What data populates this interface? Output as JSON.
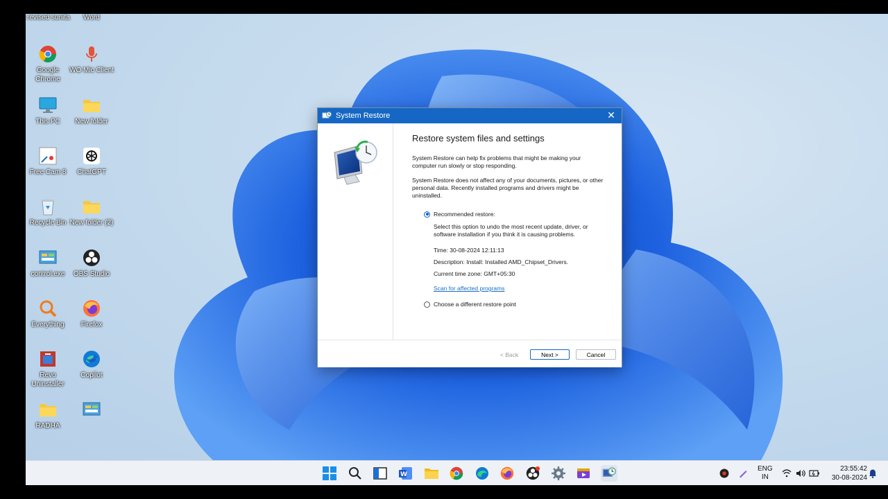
{
  "desktop": {
    "top_labels": [
      "revised sunita",
      "Word"
    ],
    "icons": [
      {
        "label": "Google Chrome",
        "icon": "chrome-icon"
      },
      {
        "label": "WO Mic Client",
        "icon": "microphone-icon"
      },
      {
        "label": "This PC",
        "icon": "monitor-icon"
      },
      {
        "label": "New folder",
        "icon": "folder-icon"
      },
      {
        "label": "Free Cam 8",
        "icon": "freecam-icon"
      },
      {
        "label": "ChatGPT",
        "icon": "chatgpt-icon"
      },
      {
        "label": "Recycle Bin",
        "icon": "recycle-bin-icon"
      },
      {
        "label": "New folder (2)",
        "icon": "folder-icon"
      },
      {
        "label": "control.exe",
        "icon": "control-panel-icon"
      },
      {
        "label": "OBS Studio",
        "icon": "obs-icon"
      },
      {
        "label": "Everything",
        "icon": "search-everything-icon"
      },
      {
        "label": "Firefox",
        "icon": "firefox-icon"
      },
      {
        "label": "Revo Uninstaller",
        "icon": "revo-icon"
      },
      {
        "label": "Copilot",
        "icon": "copilot-icon"
      },
      {
        "label": "RADHA",
        "icon": "folder-icon"
      },
      {
        "label": "",
        "icon": "control-panel-icon"
      }
    ]
  },
  "dialog": {
    "title": "System Restore",
    "heading": "Restore system files and settings",
    "para1": "System Restore can help fix problems that might be making your computer run slowly or stop responding.",
    "para2": "System Restore does not affect any of your documents, pictures, or other personal data. Recently installed programs and drivers might be uninstalled.",
    "option_recommended": "Recommended restore:",
    "option_recommended_desc": "Select this option to undo the most recent update, driver, or software installation if you think it is causing problems.",
    "time": "Time: 30-08-2024 12:11:13",
    "description": "Description: Install: Installed AMD_Chipset_Drivers.",
    "timezone": "Current time zone: GMT+05:30",
    "scan_link": "Scan for affected programs",
    "option_different": "Choose a different restore point",
    "back_label": "< Back",
    "next_label": "Next >",
    "cancel_label": "Cancel",
    "selected_option": "recommended"
  },
  "taskbar": {
    "apps": [
      "windows-start-icon",
      "search-icon",
      "task-view-icon",
      "word-icon",
      "file-explorer-icon",
      "chrome-icon",
      "edge-icon",
      "firefox-icon",
      "obs-icon",
      "settings-gear-icon",
      "media-player-icon",
      "system-restore-icon"
    ],
    "lang_top": "ENG",
    "lang_bottom": "IN",
    "time": "23:55:42",
    "date": "30-08-2024"
  },
  "colors": {
    "titlebar": "#1667c4",
    "link": "#1a6fc4",
    "wallpaper_blue": "#1f5fd8"
  }
}
